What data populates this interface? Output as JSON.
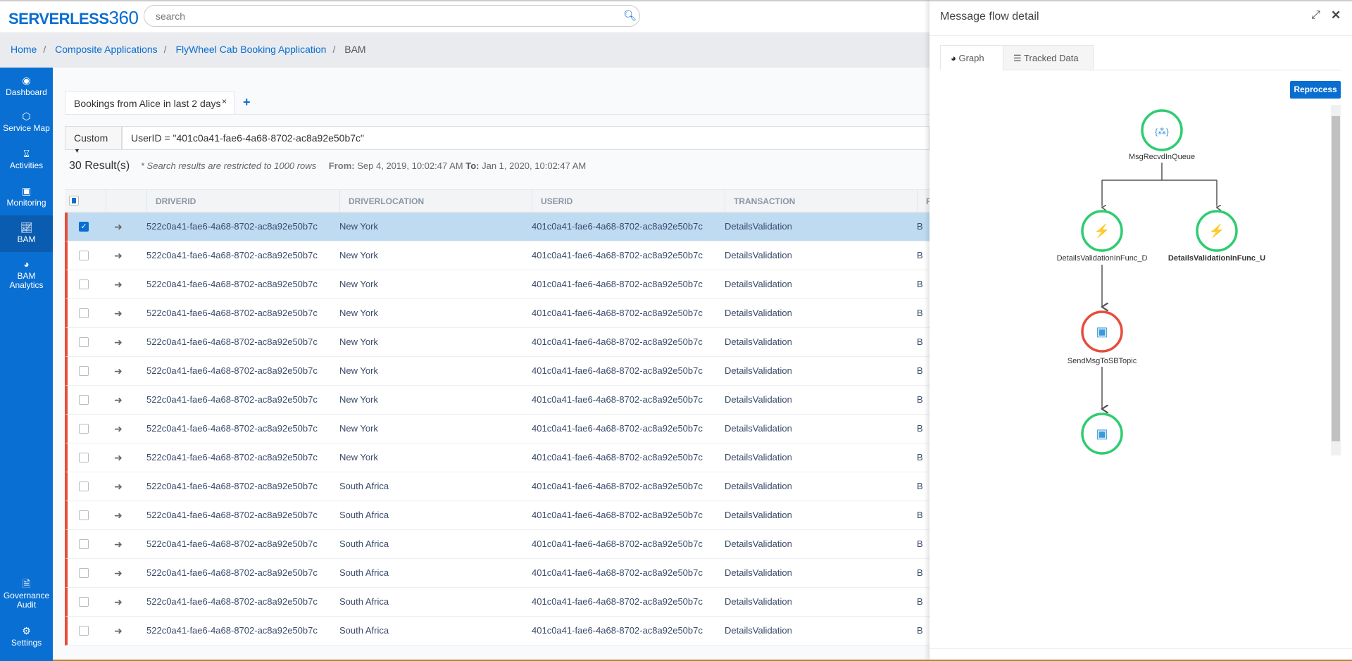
{
  "header": {
    "logo": "SERVERLESS",
    "logo_num": "360",
    "search_placeholder": "search"
  },
  "breadcrumb": [
    "Home",
    "Composite Applications",
    "FlyWheel Cab Booking Application",
    "BAM"
  ],
  "sidebar": {
    "items": [
      {
        "label": "Dashboard",
        "icon": "dashboard-icon"
      },
      {
        "label": "Service Map",
        "icon": "service-map-icon"
      },
      {
        "label": "Activities",
        "icon": "hourglass-icon"
      },
      {
        "label": "Monitoring",
        "icon": "laptop-icon"
      },
      {
        "label": "BAM",
        "icon": "chart-line-icon",
        "active": true
      },
      {
        "label": "BAM Analytics",
        "icon": "pie-chart-icon"
      },
      {
        "label": "Governance Audit",
        "icon": "document-icon"
      },
      {
        "label": "Settings",
        "icon": "gear-icon"
      }
    ]
  },
  "main": {
    "tab_label": "Bookings from Alice in last 2 days",
    "tab_close": "×",
    "tab_add": "+",
    "filter_mode": "Custom",
    "query": "UserID = \"401c0a41-fae6-4a68-8702-ac8a92e50b7c\"",
    "results_count": "30 Result(s)",
    "results_note": "* Search results are restricted to 1000 rows",
    "from_label": "From:",
    "from_value": "Sep 4, 2019, 10:02:47 AM",
    "to_label": "To:",
    "to_value": "Jan 1, 2020, 10:02:47 AM",
    "columns": [
      "DRIVERID",
      "DRIVERLOCATION",
      "USERID",
      "TRANSACTION",
      "P"
    ],
    "rows": [
      {
        "selected": true,
        "driverid": "522c0a41-fae6-4a68-8702-ac8a92e50b7c",
        "location": "New York",
        "userid": "401c0a41-fae6-4a68-8702-ac8a92e50b7c",
        "transaction": "DetailsValidation",
        "p": "B"
      },
      {
        "driverid": "522c0a41-fae6-4a68-8702-ac8a92e50b7c",
        "location": "New York",
        "userid": "401c0a41-fae6-4a68-8702-ac8a92e50b7c",
        "transaction": "DetailsValidation",
        "p": "B"
      },
      {
        "driverid": "522c0a41-fae6-4a68-8702-ac8a92e50b7c",
        "location": "New York",
        "userid": "401c0a41-fae6-4a68-8702-ac8a92e50b7c",
        "transaction": "DetailsValidation",
        "p": "B"
      },
      {
        "driverid": "522c0a41-fae6-4a68-8702-ac8a92e50b7c",
        "location": "New York",
        "userid": "401c0a41-fae6-4a68-8702-ac8a92e50b7c",
        "transaction": "DetailsValidation",
        "p": "B"
      },
      {
        "driverid": "522c0a41-fae6-4a68-8702-ac8a92e50b7c",
        "location": "New York",
        "userid": "401c0a41-fae6-4a68-8702-ac8a92e50b7c",
        "transaction": "DetailsValidation",
        "p": "B"
      },
      {
        "driverid": "522c0a41-fae6-4a68-8702-ac8a92e50b7c",
        "location": "New York",
        "userid": "401c0a41-fae6-4a68-8702-ac8a92e50b7c",
        "transaction": "DetailsValidation",
        "p": "B"
      },
      {
        "driverid": "522c0a41-fae6-4a68-8702-ac8a92e50b7c",
        "location": "New York",
        "userid": "401c0a41-fae6-4a68-8702-ac8a92e50b7c",
        "transaction": "DetailsValidation",
        "p": "B"
      },
      {
        "driverid": "522c0a41-fae6-4a68-8702-ac8a92e50b7c",
        "location": "New York",
        "userid": "401c0a41-fae6-4a68-8702-ac8a92e50b7c",
        "transaction": "DetailsValidation",
        "p": "B"
      },
      {
        "driverid": "522c0a41-fae6-4a68-8702-ac8a92e50b7c",
        "location": "New York",
        "userid": "401c0a41-fae6-4a68-8702-ac8a92e50b7c",
        "transaction": "DetailsValidation",
        "p": "B"
      },
      {
        "driverid": "522c0a41-fae6-4a68-8702-ac8a92e50b7c",
        "location": "South Africa",
        "userid": "401c0a41-fae6-4a68-8702-ac8a92e50b7c",
        "transaction": "DetailsValidation",
        "p": "B"
      },
      {
        "driverid": "522c0a41-fae6-4a68-8702-ac8a92e50b7c",
        "location": "South Africa",
        "userid": "401c0a41-fae6-4a68-8702-ac8a92e50b7c",
        "transaction": "DetailsValidation",
        "p": "B"
      },
      {
        "driverid": "522c0a41-fae6-4a68-8702-ac8a92e50b7c",
        "location": "South Africa",
        "userid": "401c0a41-fae6-4a68-8702-ac8a92e50b7c",
        "transaction": "DetailsValidation",
        "p": "B"
      },
      {
        "driverid": "522c0a41-fae6-4a68-8702-ac8a92e50b7c",
        "location": "South Africa",
        "userid": "401c0a41-fae6-4a68-8702-ac8a92e50b7c",
        "transaction": "DetailsValidation",
        "p": "B"
      },
      {
        "driverid": "522c0a41-fae6-4a68-8702-ac8a92e50b7c",
        "location": "South Africa",
        "userid": "401c0a41-fae6-4a68-8702-ac8a92e50b7c",
        "transaction": "DetailsValidation",
        "p": "B"
      },
      {
        "driverid": "522c0a41-fae6-4a68-8702-ac8a92e50b7c",
        "location": "South Africa",
        "userid": "401c0a41-fae6-4a68-8702-ac8a92e50b7c",
        "transaction": "DetailsValidation",
        "p": "B"
      }
    ]
  },
  "panel": {
    "title": "Message flow detail",
    "tabs": [
      {
        "label": "Graph",
        "icon": "pie-chart-icon"
      },
      {
        "label": "Tracked Data",
        "icon": "list-icon"
      }
    ],
    "reprocess_label": "Reprocess",
    "nodes": [
      {
        "label": "MsgRecvdInQueue",
        "status": "success",
        "icon": "logic-app-icon"
      },
      {
        "label": "DetailsValidationInFunc_D",
        "status": "success",
        "icon": "function-icon"
      },
      {
        "label": "DetailsValidationInFunc_U",
        "status": "success",
        "icon": "function-icon",
        "bold": true
      },
      {
        "label": "SendMsgToSBTopic",
        "status": "error",
        "icon": "cube-icon"
      },
      {
        "label": "",
        "status": "success",
        "icon": "cube-icon"
      }
    ],
    "colors": {
      "success": "#2ecc71",
      "error": "#e74c3c",
      "accent": "#0a6ed1"
    }
  }
}
